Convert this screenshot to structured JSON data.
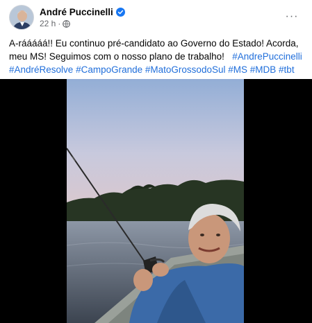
{
  "post": {
    "author": "André Puccinelli",
    "timestamp": "22 h",
    "dot": "·",
    "text_plain_1": "A-rááááá!! Eu continuo pré-candidato ao Governo do Estado! Acorda, meu MS! Seguimos com o nosso plano de trabalho!",
    "hashtags": [
      "#AndrePuccinelli",
      "#AndréResolve",
      "#CampoGrande",
      "#MatoGrossodoSul",
      "#MS",
      "#MDB",
      "#tbt"
    ],
    "more_label": "···"
  },
  "icons": {
    "verified": "verified-badge-icon",
    "privacy": "globe-icon",
    "more": "more-options-icon"
  },
  "colors": {
    "hashtag": "#216fdb",
    "verified": "#1877f2",
    "secondary_text": "#65676b"
  }
}
